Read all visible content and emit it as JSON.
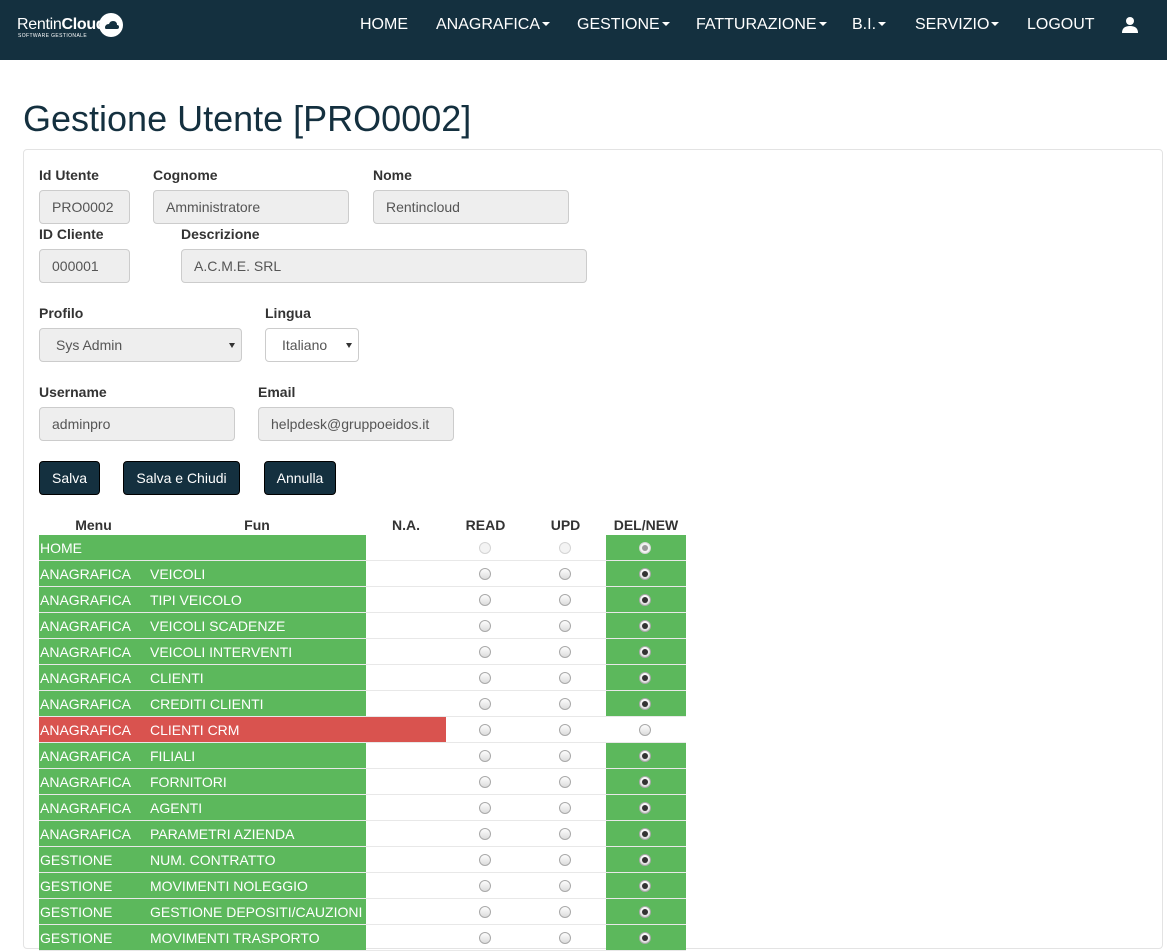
{
  "app": {
    "logo_brand_a": "Rentin",
    "logo_brand_b": "Cloud",
    "logo_sub": "SOFTWARE GESTIONALE"
  },
  "nav": {
    "home": "HOME",
    "anagrafica": "ANAGRAFICA",
    "gestione": "GESTIONE",
    "fatturazione": "FATTURAZIONE",
    "bi": "B.I.",
    "servizio": "SERVIZIO",
    "logout": "LOGOUT",
    "user_icon": "user-icon"
  },
  "page": {
    "title": "Gestione Utente [PRO0002]"
  },
  "form": {
    "id_utente": {
      "label": "Id Utente",
      "value": "PRO0002"
    },
    "cognome": {
      "label": "Cognome",
      "value": "Amministratore"
    },
    "nome": {
      "label": "Nome",
      "value": "Rentincloud"
    },
    "id_cliente": {
      "label": "ID Cliente",
      "value": "000001"
    },
    "descrizione": {
      "label": "Descrizione",
      "value": "A.C.M.E. SRL"
    },
    "profilo": {
      "label": "Profilo",
      "value": "Sys Admin"
    },
    "lingua": {
      "label": "Lingua",
      "value": "Italiano"
    },
    "username": {
      "label": "Username",
      "value": "adminpro"
    },
    "email": {
      "label": "Email",
      "value": "helpdesk@gruppoeidos.it"
    }
  },
  "buttons": {
    "salva": "Salva",
    "salva_chiudi": "Salva e Chiudi",
    "annulla": "Annulla"
  },
  "permissions": {
    "headers": {
      "menu": "Menu",
      "fun": "Fun",
      "na": "N.A.",
      "read": "READ",
      "upd": "UPD",
      "delnew": "DEL/NEW"
    },
    "colors": {
      "granted": "#5cb85c",
      "denied": "#d9534f"
    },
    "rows": [
      {
        "menu": "HOME",
        "fun": "",
        "level": "DEL/NEW",
        "status": "granted",
        "faint": true
      },
      {
        "menu": "ANAGRAFICA",
        "fun": "VEICOLI",
        "level": "DEL/NEW",
        "status": "granted"
      },
      {
        "menu": "ANAGRAFICA",
        "fun": "TIPI VEICOLO",
        "level": "DEL/NEW",
        "status": "granted"
      },
      {
        "menu": "ANAGRAFICA",
        "fun": "VEICOLI SCADENZE",
        "level": "DEL/NEW",
        "status": "granted"
      },
      {
        "menu": "ANAGRAFICA",
        "fun": "VEICOLI INTERVENTI",
        "level": "DEL/NEW",
        "status": "granted"
      },
      {
        "menu": "ANAGRAFICA",
        "fun": "CLIENTI",
        "level": "DEL/NEW",
        "status": "granted"
      },
      {
        "menu": "ANAGRAFICA",
        "fun": "CREDITI CLIENTI",
        "level": "DEL/NEW",
        "status": "granted"
      },
      {
        "menu": "ANAGRAFICA",
        "fun": "CLIENTI CRM",
        "level": "N.A.",
        "status": "denied"
      },
      {
        "menu": "ANAGRAFICA",
        "fun": "FILIALI",
        "level": "DEL/NEW",
        "status": "granted"
      },
      {
        "menu": "ANAGRAFICA",
        "fun": "FORNITORI",
        "level": "DEL/NEW",
        "status": "granted"
      },
      {
        "menu": "ANAGRAFICA",
        "fun": "AGENTI",
        "level": "DEL/NEW",
        "status": "granted"
      },
      {
        "menu": "ANAGRAFICA",
        "fun": "PARAMETRI AZIENDA",
        "level": "DEL/NEW",
        "status": "granted"
      },
      {
        "menu": "GESTIONE",
        "fun": "NUM. CONTRATTO",
        "level": "DEL/NEW",
        "status": "granted"
      },
      {
        "menu": "GESTIONE",
        "fun": "MOVIMENTI NOLEGGIO",
        "level": "DEL/NEW",
        "status": "granted"
      },
      {
        "menu": "GESTIONE",
        "fun": "GESTIONE DEPOSITI/CAUZIONI",
        "level": "DEL/NEW",
        "status": "granted"
      },
      {
        "menu": "GESTIONE",
        "fun": "MOVIMENTI TRASPORTO",
        "level": "DEL/NEW",
        "status": "granted"
      }
    ]
  }
}
